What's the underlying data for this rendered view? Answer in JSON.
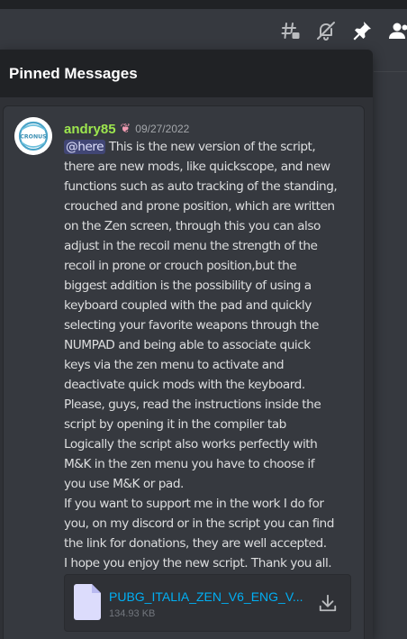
{
  "header": {
    "icons": [
      "threads-icon",
      "mute-icon",
      "pin-icon",
      "members-icon"
    ]
  },
  "panel": {
    "title": "Pinned Messages"
  },
  "message": {
    "author": "andry85",
    "author_badge": "brain-icon",
    "timestamp": "09/27/2022",
    "avatar_text": "CRONUS",
    "mention": "@here",
    "lines": [
      " This is the new version of the script,",
      "there are new mods, like quickscope, and new",
      "functions such as auto tracking of the standing,",
      "crouched and prone position, which are written",
      "on the Zen screen, through this you can also",
      "adjust in the recoil menu the strength of the",
      "recoil in prone or crouch position,but the",
      "biggest addition is the possibility of using a",
      "keyboard coupled with the pad and quickly",
      "selecting your favorite weapons through the",
      "NUMPAD and being able to associate quick",
      "keys via the zen menu to activate and",
      "deactivate quick mods with the keyboard.",
      "Please, guys, read the instructions inside the",
      "script by opening it in the compiler tab",
      "Logically the script also works perfectly with",
      "M&K in the zen menu you have to choose if",
      "you use M&K or pad.",
      "If you want to support me in the work I do for",
      "you, on my discord or in the script you can find",
      "the link for donations, they are well accepted.",
      "I hope you enjoy the new script. Thank you all."
    ],
    "attachment": {
      "filename": "PUBG_ITALIA_ZEN_V6_ENG_V...",
      "size": "134.93 KB"
    }
  },
  "colors": {
    "background": "#36393f",
    "panel": "#2f3136",
    "panel_header": "#202225",
    "username": "#9de64e",
    "link": "#00aff4",
    "mention_bg": "#414675"
  }
}
